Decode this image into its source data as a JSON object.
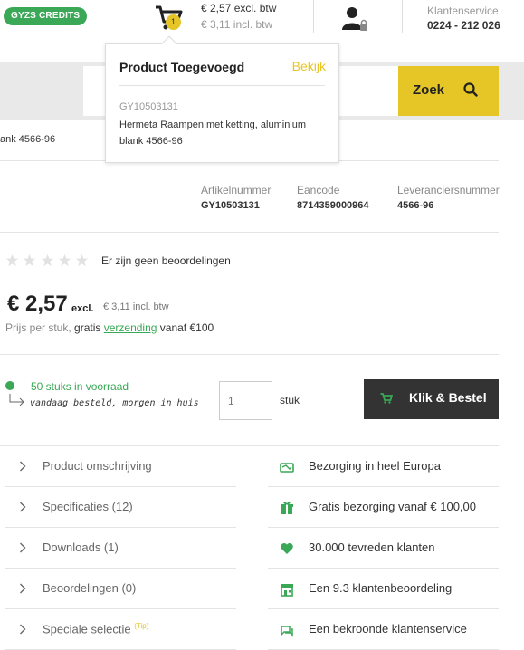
{
  "header": {
    "credits_label": "GYZS CREDITS",
    "cart_count": "1",
    "cart_price_excl": "€ 2,57 excl. btw",
    "cart_price_incl": "€ 3,11 incl. btw",
    "service_label": "Klantenservice",
    "service_phone": "0224 - 212 026"
  },
  "search": {
    "placeholder": "",
    "button_label": "Zoek"
  },
  "popup": {
    "title": "Product Toegevoegd",
    "view_label": "Bekijk",
    "sku": "GY10503131",
    "product_name": "Hermeta Raampen met ketting, aluminium blank 4566-96"
  },
  "breadcrumb_fragment": "ank 4566-96",
  "specs": [
    {
      "label": "Artikelnummer",
      "value": "GY10503131"
    },
    {
      "label": "Eancode",
      "value": "8714359000964"
    },
    {
      "label": "Leveranciersnummer",
      "value": "4566-96"
    }
  ],
  "rating": {
    "stars": 0,
    "max": 5,
    "text": "Er zijn geen beoordelingen"
  },
  "price": {
    "amount": "€ 2,57",
    "excl_label": "excl.",
    "incl_text": "€ 3,11 incl. btw",
    "per_unit": "Prijs per stuk,",
    "gratis": "gratis",
    "shipping_link": "verzending",
    "threshold": "vanaf €100"
  },
  "stock": {
    "status": "50 stuks  in voorraad",
    "delivery": "vandaag besteld, morgen in huis"
  },
  "order": {
    "quantity_placeholder": "1",
    "unit": "stuk",
    "button_label": "Klik & Bestel"
  },
  "accordion": [
    {
      "label": "Product omschrijving",
      "tip": ""
    },
    {
      "label": "Specificaties (12)",
      "tip": ""
    },
    {
      "label": "Downloads (1)",
      "tip": ""
    },
    {
      "label": "Beoordelingen (0)",
      "tip": ""
    },
    {
      "label": "Speciale selectie",
      "tip": "(Tip)"
    }
  ],
  "usps": [
    {
      "icon": "delivery-icon",
      "label": "Bezorging in heel Europa"
    },
    {
      "icon": "gift-icon",
      "label": "Gratis bezorging vanaf € 100,00"
    },
    {
      "icon": "heart-icon",
      "label": "30.000 tevreden klanten"
    },
    {
      "icon": "store-icon",
      "label": "Een 9.3 klantenbeoordeling"
    },
    {
      "icon": "chat-icon",
      "label": "Een bekroonde klantenservice"
    }
  ],
  "colors": {
    "accent_yellow": "#e6c526",
    "brand_green": "#3aa856",
    "dark_button": "#333333"
  }
}
